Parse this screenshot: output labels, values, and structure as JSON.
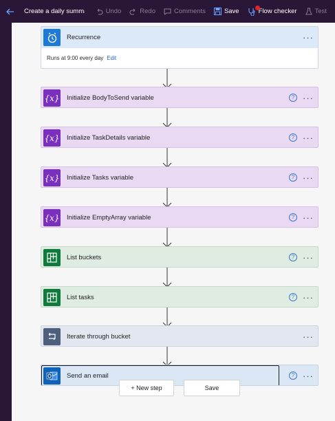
{
  "toolbar": {
    "flow_name": "Create a daily summary",
    "undo": "Undo",
    "redo": "Redo",
    "comments": "Comments",
    "save": "Save",
    "flow_checker": "Flow checker",
    "test": "Test"
  },
  "steps": [
    {
      "title": "Recurrence",
      "kind": "recurrence",
      "body_text": "Runs at 9:00 every day",
      "edit_label": "Edit",
      "icon": "clock-icon"
    },
    {
      "title": "Initialize BodyToSend variable",
      "kind": "variable",
      "icon_glyph": "{x}",
      "icon": "variable-icon"
    },
    {
      "title": "Initialize TaskDetails variable",
      "kind": "variable",
      "icon_glyph": "{x}",
      "icon": "variable-icon"
    },
    {
      "title": "Initialize Tasks variable",
      "kind": "variable",
      "icon_glyph": "{x}",
      "icon": "variable-icon"
    },
    {
      "title": "Initialize EmptyArray variable",
      "kind": "variable",
      "icon_glyph": "{x}",
      "icon": "variable-icon"
    },
    {
      "title": "List buckets",
      "kind": "planner",
      "icon": "planner-icon"
    },
    {
      "title": "List tasks",
      "kind": "planner",
      "icon": "planner-icon"
    },
    {
      "title": "Iterate through bucket",
      "kind": "loop",
      "icon": "loop-icon"
    },
    {
      "title": "Send an email",
      "kind": "email",
      "icon": "outlook-icon",
      "selected": true
    }
  ],
  "step_more_label": "···",
  "help_label": "?",
  "footer": {
    "new_step": "+ New step",
    "save": "Save"
  },
  "colors": {
    "background": "#2a1636",
    "variable": "#7a2fbf",
    "planner": "#0f7a3c",
    "loop": "#4e5f7e",
    "email": "#0f63b8",
    "link": "#1e63c5"
  }
}
